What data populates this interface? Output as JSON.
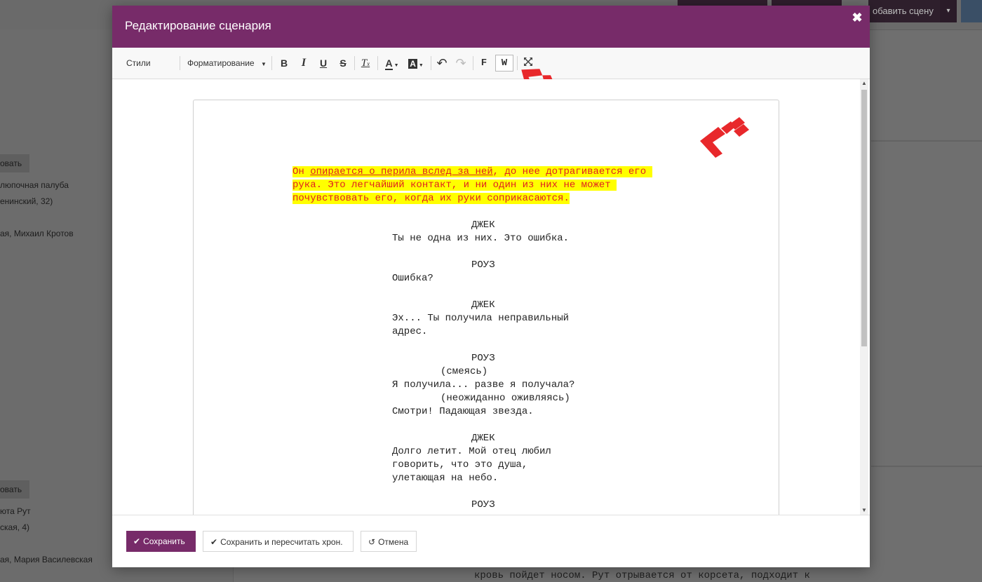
{
  "background": {
    "add_scene_label": "обавить сцену",
    "sidebar_block1": {
      "chip": "овать",
      "line1": "люпочная палуба",
      "line2": "енинский, 32)",
      "line3": "ая, Михаил Кротов"
    },
    "sidebar_block2": {
      "chip": "овать",
      "line1": "юта Рут",
      "line2": "ская, 4)",
      "line3": "ая, Мария Василевская"
    },
    "script_fragment": "кровь пойдет носом. Рут отрывается от корсета, подходит к"
  },
  "modal": {
    "title": "Редактирование сценария",
    "close_glyph": "✖"
  },
  "toolbar": {
    "styles_label": "Стили",
    "format_label": "Форматирование",
    "bold": "B",
    "italic": "I",
    "underline": "U",
    "strike": "S",
    "clear_format": "T",
    "clear_format_sub": "x",
    "text_color": "A",
    "bg_color": "A",
    "undo": "↶",
    "redo": "↷",
    "f_button": "F",
    "w_button": "W"
  },
  "script": {
    "action_lines": [
      {
        "pre": "Он ",
        "underlined": "опирается о перила вслед за ней",
        "post": ", до нее дотрагивается его "
      },
      {
        "pre": "рука. Это легчайший контакт, и ни один из них не может ",
        "underlined": "",
        "post": ""
      },
      {
        "pre": "почувствовать его, когда их руки соприкасаются.",
        "underlined": "",
        "post": ""
      }
    ],
    "block1_character": "ДЖЕК",
    "block1_dialogue": [
      "Ты не одна из них. Это ошибка."
    ],
    "block2_character": "РОУЗ",
    "block2_dialogue": [
      "Ошибка?"
    ],
    "block3_character": "ДЖЕК",
    "block3_dialogue": [
      "Эх... Ты получила неправильный",
      "адрес."
    ],
    "block4_character": "РОУЗ",
    "block4_paren1": "(смеясь)",
    "block4_dialogue1": "Я получила... разве я получала?",
    "block4_paren2": "(неожиданно оживляясь)",
    "block4_dialogue2": "Смотри! Падающая звезда.",
    "block5_character": "ДЖЕК",
    "block5_dialogue": [
      "Долго летит. Мой отец любил",
      "говорить, что это душа,",
      "улетающая на небо."
    ],
    "block6_character": "РОУЗ"
  },
  "footer": {
    "save_label": "Сохранить",
    "save_recalc_label": "Сохранить и пересчитать хрон.",
    "cancel_label": "Отмена"
  },
  "colors": {
    "brand": "#772b69",
    "highlight_bg": "#ffff00",
    "highlight_text": "#e02020",
    "arrow": "#e8282b"
  }
}
